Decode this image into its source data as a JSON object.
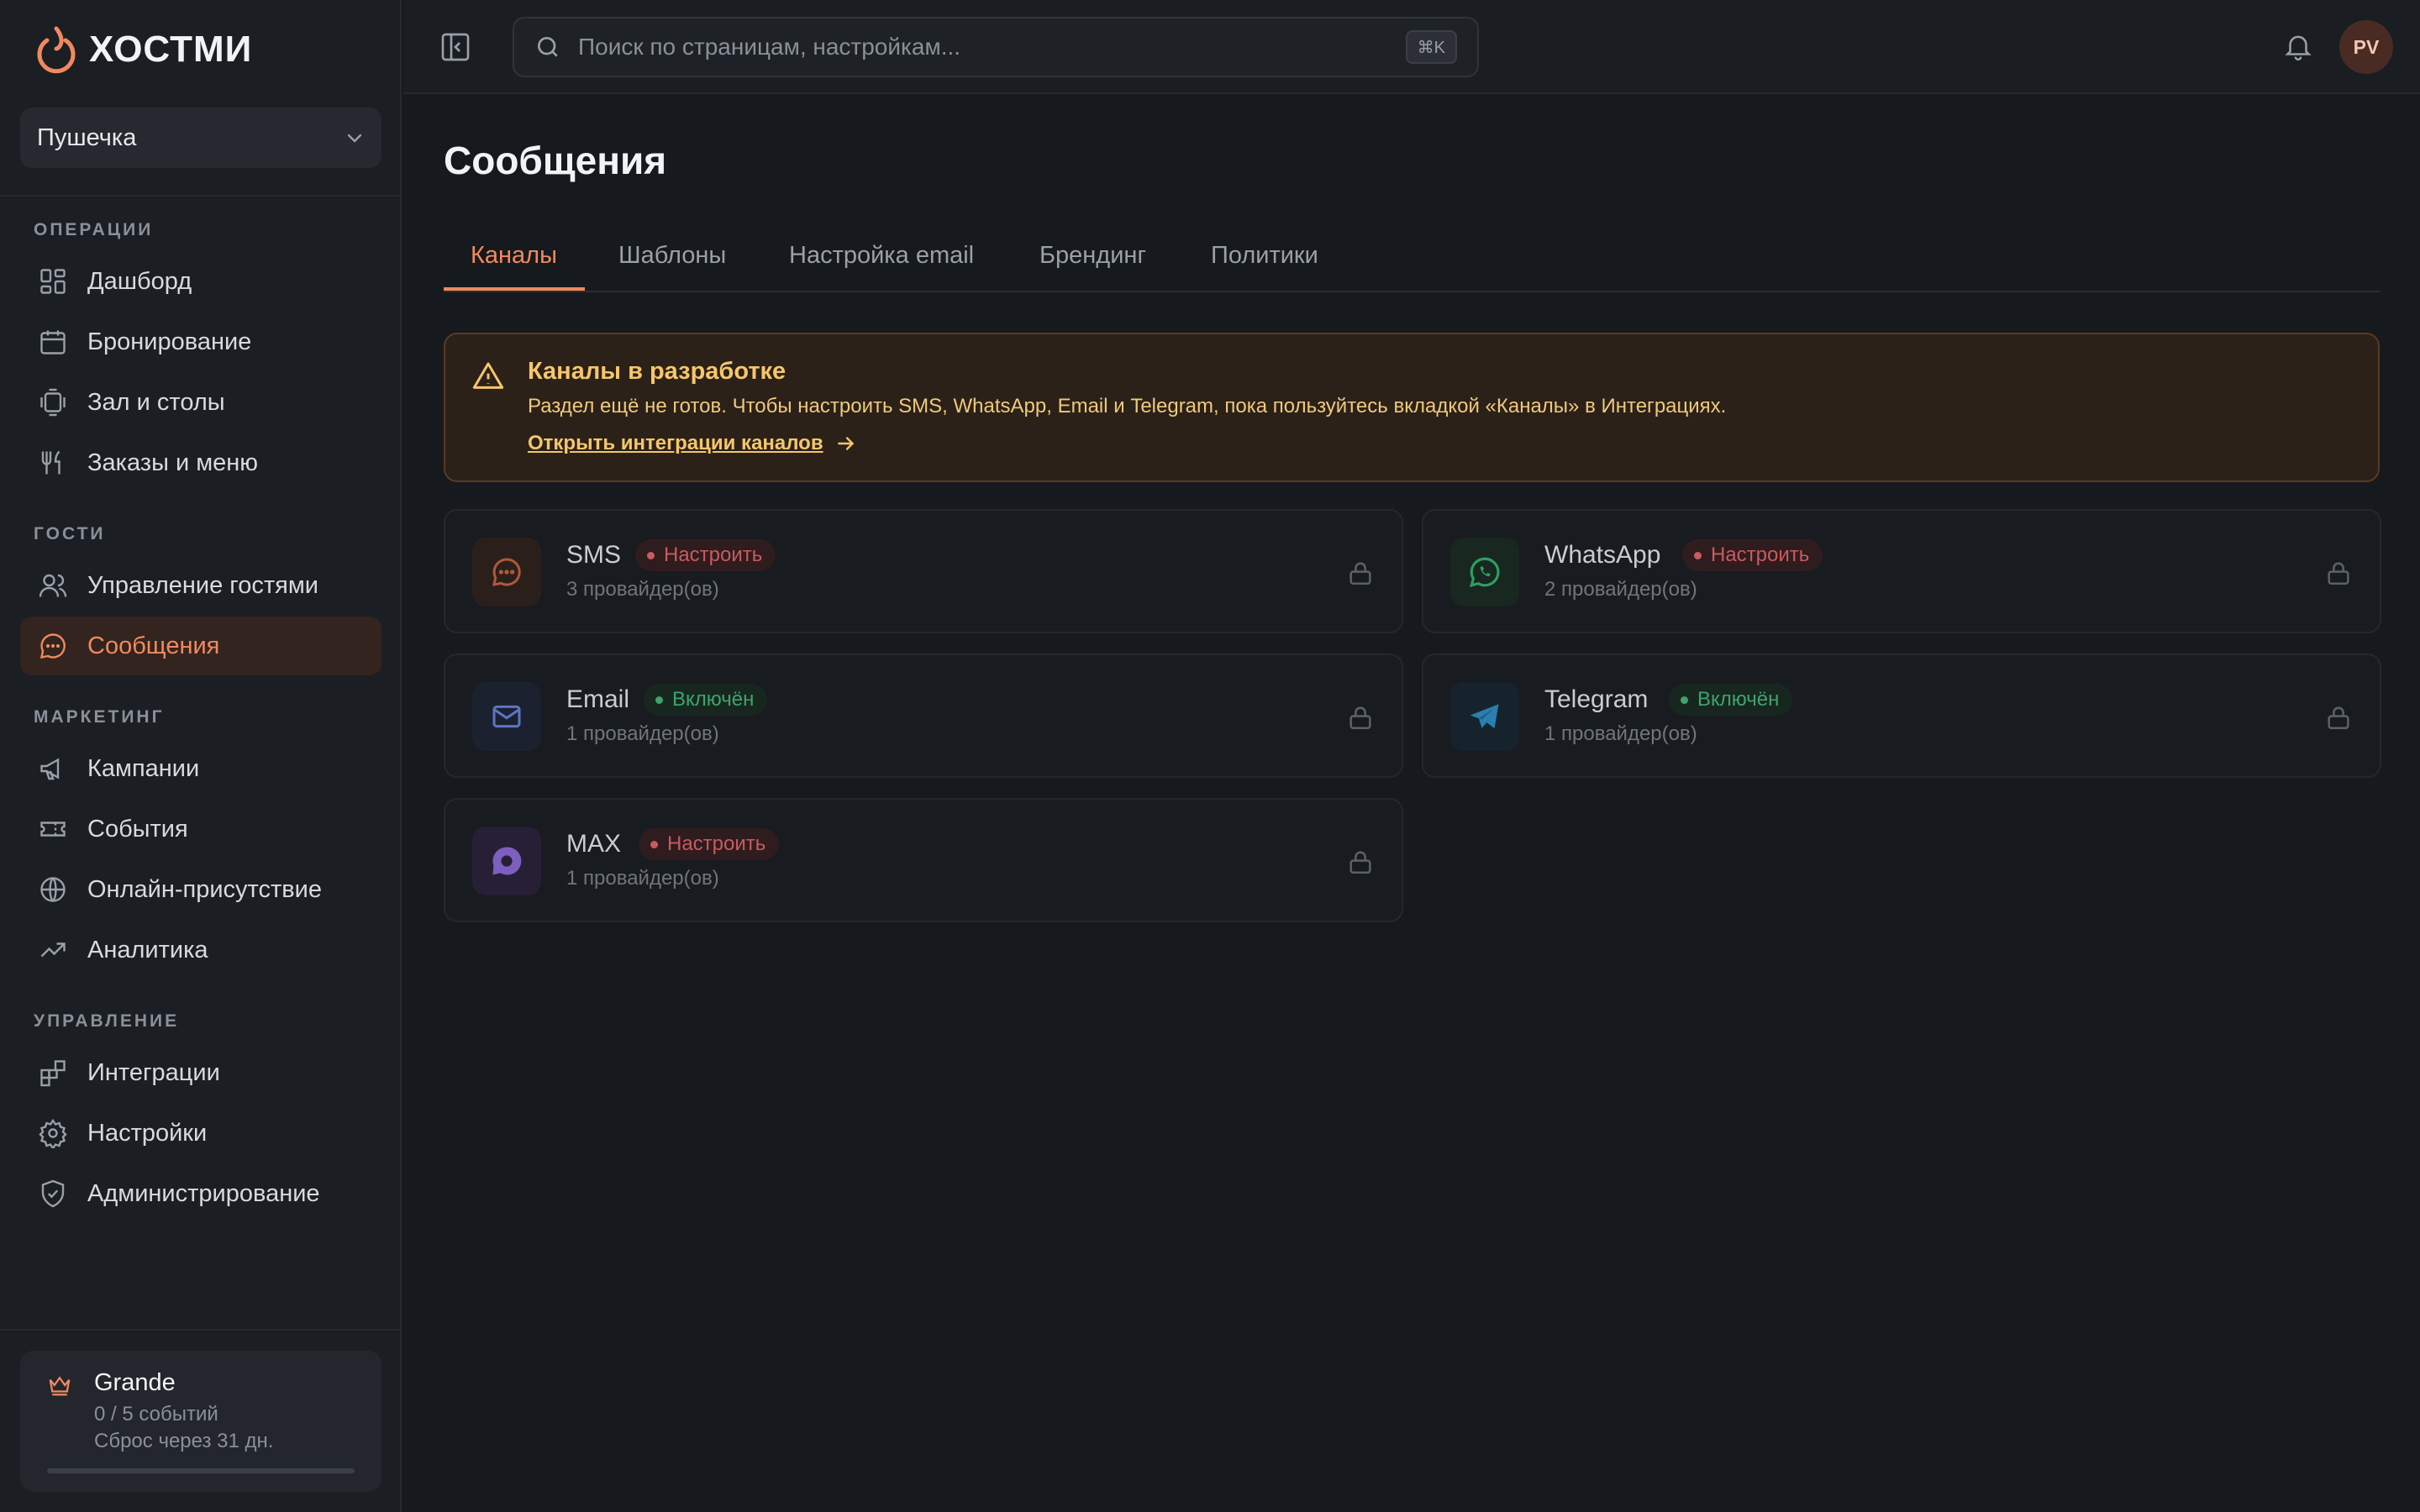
{
  "brand": {
    "name": "ХОСТМИ",
    "accent": "#f08a5e"
  },
  "venue": {
    "name": "Пушечка"
  },
  "sidebar": {
    "sections": [
      {
        "label": "ОПЕРАЦИИ",
        "items": [
          {
            "label": "Дашборд",
            "icon": "dashboard-icon"
          },
          {
            "label": "Бронирование",
            "icon": "calendar-icon"
          },
          {
            "label": "Зал и столы",
            "icon": "tables-icon"
          },
          {
            "label": "Заказы и меню",
            "icon": "utensils-icon"
          }
        ]
      },
      {
        "label": "ГОСТИ",
        "items": [
          {
            "label": "Управление гостями",
            "icon": "users-icon"
          },
          {
            "label": "Сообщения",
            "icon": "message-icon",
            "active": true
          }
        ]
      },
      {
        "label": "МАРКЕТИНГ",
        "items": [
          {
            "label": "Кампании",
            "icon": "megaphone-icon"
          },
          {
            "label": "События",
            "icon": "ticket-icon"
          },
          {
            "label": "Онлайн-присутствие",
            "icon": "globe-icon"
          },
          {
            "label": "Аналитика",
            "icon": "trending-icon"
          }
        ]
      },
      {
        "label": "УПРАВЛЕНИЕ",
        "items": [
          {
            "label": "Интеграции",
            "icon": "integrations-icon"
          },
          {
            "label": "Настройки",
            "icon": "gear-icon"
          },
          {
            "label": "Администрирование",
            "icon": "shield-icon"
          }
        ]
      }
    ]
  },
  "plan": {
    "name": "Grande",
    "usage": "0 / 5 событий",
    "reset": "Сброс через 31 дн.",
    "progress": 0
  },
  "search": {
    "placeholder": "Поиск по страницам, настройкам...",
    "shortcut": "⌘K"
  },
  "user": {
    "initials": "PV"
  },
  "page": {
    "title": "Сообщения"
  },
  "tabs": [
    {
      "label": "Каналы",
      "active": true
    },
    {
      "label": "Шаблоны"
    },
    {
      "label": "Настройка email"
    },
    {
      "label": "Брендинг"
    },
    {
      "label": "Политики"
    }
  ],
  "alert": {
    "title": "Каналы в разработке",
    "text": "Раздел ещё не готов. Чтобы настроить SMS, WhatsApp, Email и Telegram, пока пользуйтесь вкладкой «Каналы» в Интеграциях.",
    "link": "Открыть интеграции каналов"
  },
  "channels": [
    {
      "name": "SMS",
      "status": "Настроить",
      "state": "red",
      "providers": "3 провайдер(ов)",
      "icon": "sms-icon"
    },
    {
      "name": "WhatsApp",
      "status": "Настроить",
      "state": "red",
      "providers": "2 провайдер(ов)",
      "icon": "whatsapp-icon"
    },
    {
      "name": "Email",
      "status": "Включён",
      "state": "green",
      "providers": "1 провайдер(ов)",
      "icon": "mail-icon"
    },
    {
      "name": "Telegram",
      "status": "Включён",
      "state": "green",
      "providers": "1 провайдер(ов)",
      "icon": "telegram-icon"
    },
    {
      "name": "MAX",
      "status": "Настроить",
      "state": "red",
      "providers": "1 провайдер(ов)",
      "icon": "max-icon"
    }
  ]
}
